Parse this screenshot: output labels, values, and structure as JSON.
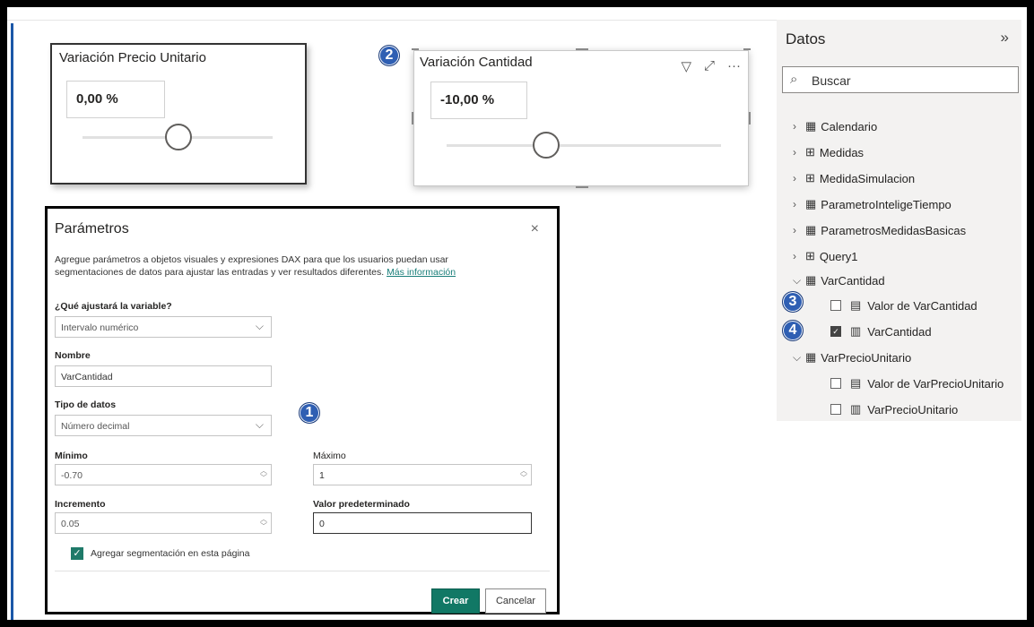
{
  "slicers": {
    "precio": {
      "title": "Variación Precio Unitario",
      "value": "0,00 %"
    },
    "cantidad": {
      "title": "Variación Cantidad",
      "value": "-10,00 %"
    }
  },
  "badges": {
    "b1": "1",
    "b2": "2",
    "b3": "3",
    "b4": "4"
  },
  "dialog": {
    "title": "Parámetros",
    "close": "×",
    "description": "Agregue parámetros a objetos visuales y expresiones DAX para que los usuarios puedan usar segmentaciones de datos para ajustar las entradas y ver resultados diferentes.",
    "link": "Más información",
    "que_label": "¿Qué ajustará la variable?",
    "que_value": "Intervalo numérico",
    "nombre_label": "Nombre",
    "nombre_value": "VarCantidad",
    "tipo_label": "Tipo de datos",
    "tipo_value": "Número decimal",
    "minimo_label": "Mínimo",
    "minimo_value": "-0.70",
    "maximo_label": "Máximo",
    "maximo_value": "1",
    "incremento_label": "Incremento",
    "incremento_value": "0.05",
    "predeterminado_label": "Valor predeterminado",
    "predeterminado_value": "0",
    "agregar_label": "Agregar segmentación en esta página",
    "crear": "Crear",
    "cancelar": "Cancelar"
  },
  "datapane": {
    "title": "Datos",
    "search_placeholder": "Buscar",
    "items": [
      "Calendario",
      "Medidas",
      "MedidaSimulacion",
      "ParametroInteligeTiempo",
      "ParametrosMedidasBasicas",
      "Query1",
      "VarCantidad",
      "Valor de VarCantidad",
      "VarCantidad",
      "VarPrecioUnitario",
      "Valor de VarPrecioUnitario",
      "VarPrecioUnitario"
    ]
  },
  "colors": {
    "accent": "#117865",
    "badge": "#2f5fb3"
  }
}
